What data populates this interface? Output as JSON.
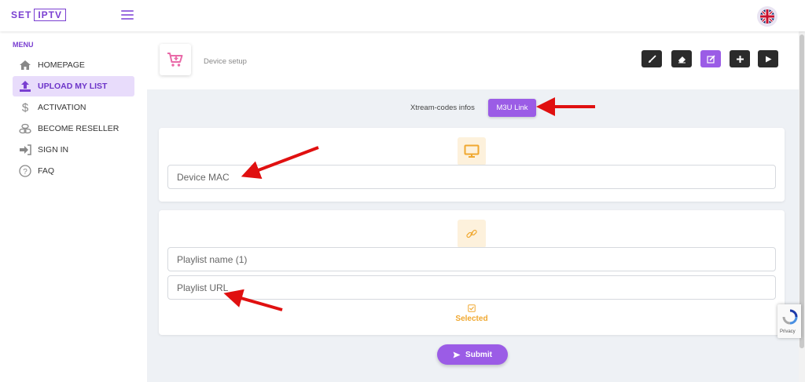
{
  "logo": {
    "part1": "SET",
    "part2": "IPTV"
  },
  "header_icons": {
    "menu": "hamburger-icon",
    "language": "uk-flag-icon"
  },
  "sidebar": {
    "title": "MENU",
    "items": [
      {
        "label": "HOMEPAGE",
        "icon": "home-icon",
        "active": false
      },
      {
        "label": "UPLOAD MY LIST",
        "icon": "upload-icon",
        "active": true
      },
      {
        "label": "ACTIVATION",
        "icon": "dollar-icon",
        "active": false
      },
      {
        "label": "BECOME RESELLER",
        "icon": "coins-icon",
        "active": false
      },
      {
        "label": "SIGN IN",
        "icon": "sign-in-icon",
        "active": false
      },
      {
        "label": "FAQ",
        "icon": "question-icon",
        "active": false
      }
    ]
  },
  "page": {
    "title": "Device setup",
    "title_icon": "cart-plus-icon",
    "toolbar": [
      "brush-icon",
      "eraser-icon",
      "edit-icon",
      "plus-icon",
      "play-icon"
    ]
  },
  "tabs": {
    "xtream": "Xtream-codes infos",
    "m3u": "M3U Link"
  },
  "device_card": {
    "icon": "monitor-icon",
    "mac_placeholder": "Device MAC"
  },
  "playlist_card": {
    "icon": "link-icon",
    "name_placeholder": "Playlist name (1)",
    "url_placeholder": "Playlist URL",
    "selected_label": "Selected",
    "selected_icon": "check-square-icon"
  },
  "submit": {
    "label": "Submit",
    "icon": "send-icon"
  },
  "recaptcha": {
    "privacy": "Privacy"
  },
  "colors": {
    "accent": "#9b5ce6",
    "highlight": "#f0a830",
    "annotation_arrow": "#e01010"
  }
}
